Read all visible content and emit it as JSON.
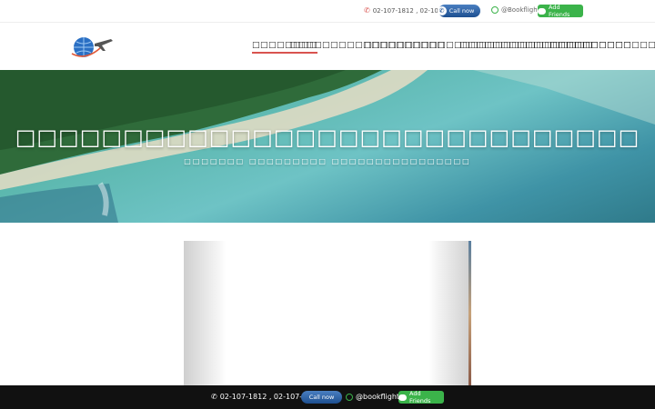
{
  "topbar": {
    "phone": "02-107-1812 , 02-107-1813",
    "call_label": "Call now",
    "line_id": "@Bookflights",
    "add_friends_label": "Add Friends"
  },
  "nav": {
    "items": [
      {
        "label": "□□□□□□□□",
        "active": true
      },
      {
        "label": "□□□□□□□□□□□□□□□□□□□",
        "active": false
      },
      {
        "label": "□□□□□□□□□□□□□□□□□□□□□□□□□□□□",
        "active": false
      },
      {
        "label": "□□□□□□□□□□□□□□□□□□□□□□□□□□",
        "active": false
      },
      {
        "label": "□□□□□□□□□□",
        "active": false
      }
    ]
  },
  "hero": {
    "title": "□□□□□□□□□□□□□□□□□□□□□□□□□□□□□",
    "subtitle": "□□□□□□□ □□□□□□□□□ □□□□□□□□□□□□□□□□"
  },
  "bottombar": {
    "phone": "02-107-1812 , 02-107-1813",
    "call_label": "Call now",
    "line_id": "@bookflights",
    "add_friends_label": "Add Friends"
  },
  "colors": {
    "accent": "#d9534f",
    "call_button": "#1d4f90",
    "line_green": "#3bb34a",
    "bottom_bar": "#111111"
  },
  "icons": {
    "phone": "phone-icon",
    "line": "line-icon",
    "logo": "globe-plane-logo"
  }
}
